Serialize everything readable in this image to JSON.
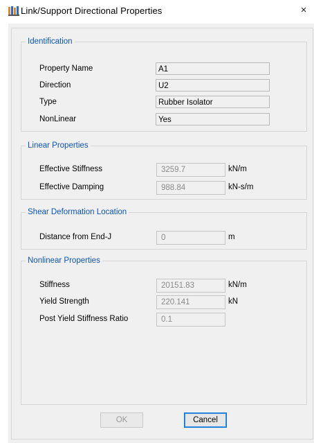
{
  "window": {
    "title": "Link/Support Directional Properties",
    "close_label": "×"
  },
  "identification": {
    "legend": "Identification",
    "fields": [
      {
        "label": "Property Name",
        "value": "A1"
      },
      {
        "label": "Direction",
        "value": "U2"
      },
      {
        "label": "Type",
        "value": "Rubber Isolator"
      },
      {
        "label": "NonLinear",
        "value": "Yes"
      }
    ]
  },
  "linear": {
    "legend": "Linear Properties",
    "fields": [
      {
        "label": "Effective Stiffness",
        "value": "3259.7",
        "unit": "kN/m"
      },
      {
        "label": "Effective Damping",
        "value": "988.84",
        "unit": "kN-s/m"
      }
    ]
  },
  "shear": {
    "legend": "Shear Deformation Location",
    "fields": [
      {
        "label": "Distance from End-J",
        "value": "0",
        "unit": "m"
      }
    ]
  },
  "nonlinear": {
    "legend": "Nonlinear Properties",
    "fields": [
      {
        "label": "Stiffness",
        "value": "20151.83",
        "unit": "kN/m"
      },
      {
        "label": "Yield Strength",
        "value": "220.141",
        "unit": "kN"
      },
      {
        "label": "Post Yield Stiffness Ratio",
        "value": "0.1",
        "unit": ""
      }
    ]
  },
  "buttons": {
    "ok": "OK",
    "cancel": "Cancel"
  },
  "colors": {
    "legend_text": "#0b55b0",
    "dialog_bg": "#f0f0f0",
    "default_button_border": "#0078d7"
  }
}
